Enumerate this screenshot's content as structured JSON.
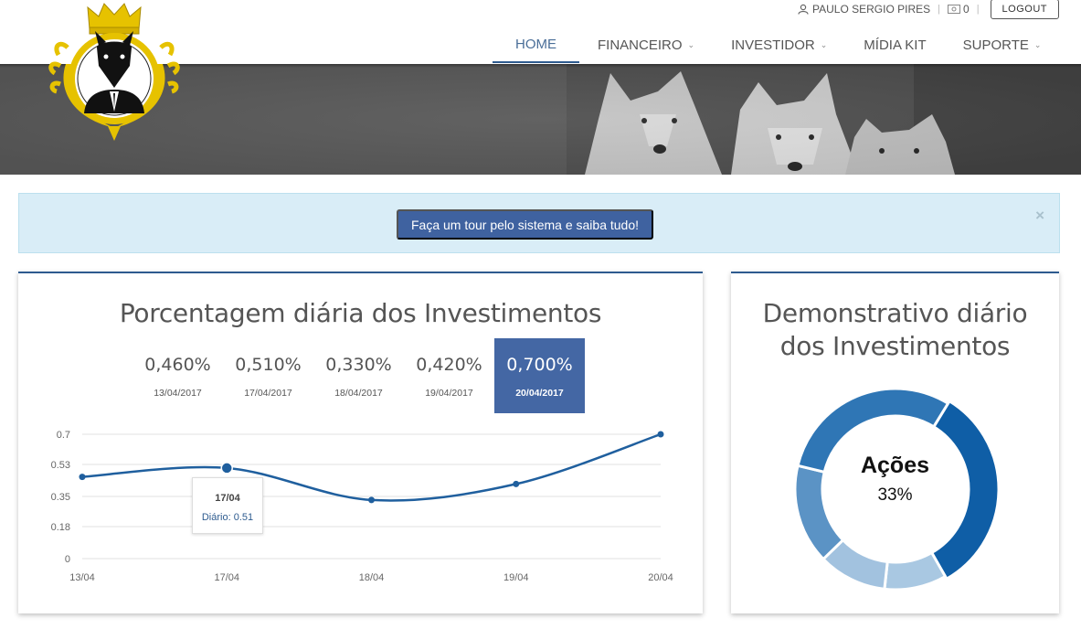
{
  "topbar": {
    "user_name": "PAULO SERGIO PIRES",
    "balance": "0",
    "logout_label": "LOGOUT"
  },
  "nav": {
    "items": [
      {
        "label": "HOME",
        "active": true,
        "has_dropdown": false
      },
      {
        "label": "FINANCEIRO",
        "active": false,
        "has_dropdown": true
      },
      {
        "label": "INVESTIDOR",
        "active": false,
        "has_dropdown": true
      },
      {
        "label": "MÍDIA KIT",
        "active": false,
        "has_dropdown": false
      },
      {
        "label": "SUPORTE",
        "active": false,
        "has_dropdown": true
      }
    ]
  },
  "alert": {
    "button_label": "Faça um tour pelo sistema e saiba tudo!",
    "close_label": "×"
  },
  "left_panel": {
    "title": "Porcentagem diária dos Investimentos",
    "percentages": [
      {
        "value": "0,460%",
        "date": "13/04/2017",
        "active": false
      },
      {
        "value": "0,510%",
        "date": "17/04/2017",
        "active": false
      },
      {
        "value": "0,330%",
        "date": "18/04/2017",
        "active": false
      },
      {
        "value": "0,420%",
        "date": "19/04/2017",
        "active": false
      },
      {
        "value": "0,700%",
        "date": "20/04/2017",
        "active": true
      }
    ],
    "tooltip": {
      "title": "17/04",
      "value": "Diário: 0.51"
    }
  },
  "right_panel": {
    "title_line1": "Demonstrativo diário",
    "title_line2": "dos Investimentos",
    "center_label": "Ações",
    "center_value": "33%"
  },
  "colors": {
    "brand_blue": "#2e5b8f",
    "button_blue": "#3f62a0",
    "alert_bg": "#d9edf7",
    "line_color": "#1f5f9e"
  },
  "chart_data": [
    {
      "type": "line",
      "categories": [
        "13/04",
        "17/04",
        "18/04",
        "19/04",
        "20/04"
      ],
      "series": [
        {
          "name": "Diário",
          "values": [
            0.46,
            0.51,
            0.33,
            0.42,
            0.7
          ]
        }
      ],
      "yticks": [
        "0",
        "0.18",
        "0.35",
        "0.53",
        "0.7"
      ],
      "ylim": [
        0,
        0.7
      ],
      "grid": true,
      "highlighted_index": 1
    },
    {
      "type": "pie",
      "donut": true,
      "labels": [
        "Ações"
      ],
      "highlighted": "Ações",
      "highlighted_value": 33,
      "slices": [
        {
          "value": 33,
          "color": "#0f5ea6"
        },
        {
          "value": 10,
          "color": "#a9c8e2"
        },
        {
          "value": 11,
          "color": "#a2c2df"
        },
        {
          "value": 16,
          "color": "#5b93c5"
        },
        {
          "value": 30,
          "color": "#2f76b5"
        }
      ]
    }
  ]
}
